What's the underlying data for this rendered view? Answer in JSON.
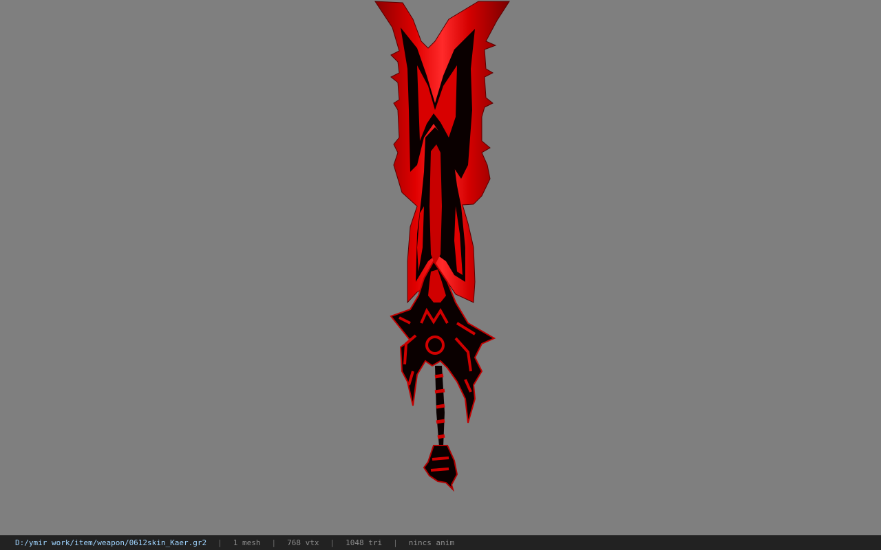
{
  "viewer": {
    "background_color": "#7f7f7f",
    "model_colors": {
      "red": "#d90000",
      "highlight": "#ff2a2a",
      "dark": "#0a0000"
    }
  },
  "statusbar": {
    "file_path": "D:/ymir work/item/weapon/0612skin_Kaer.gr2",
    "separator": "|",
    "mesh_count": "1 mesh",
    "vertex_count": "768 vtx",
    "triangle_count": "1048 tri",
    "animation": "nincs anim"
  }
}
